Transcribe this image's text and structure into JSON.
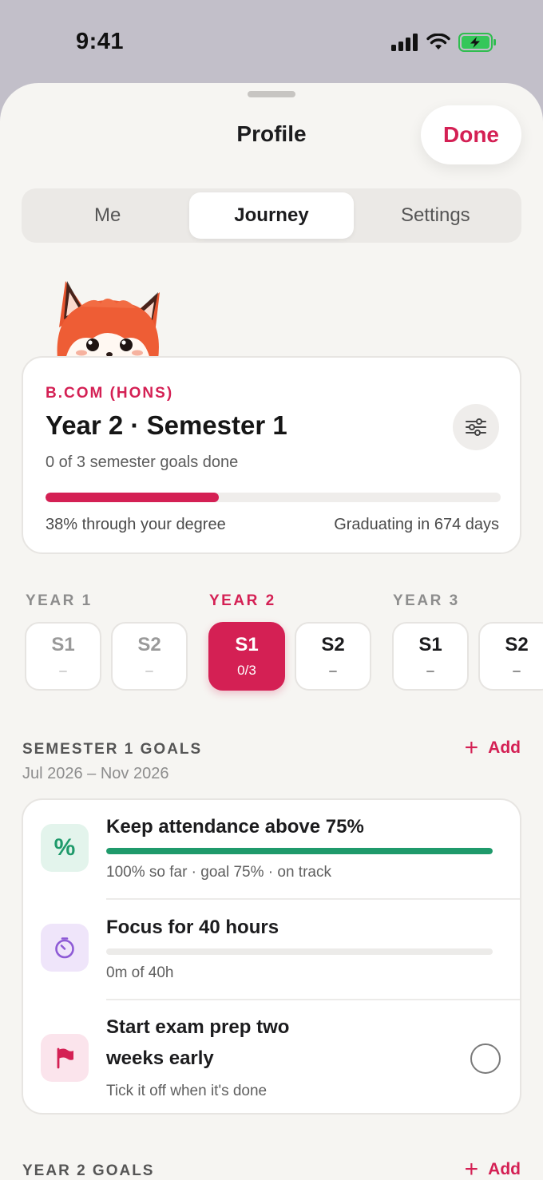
{
  "status_bar": {
    "time": "9:41"
  },
  "sheet": {
    "title": "Profile",
    "done_label": "Done"
  },
  "tabs": [
    {
      "label": "Me",
      "active": false
    },
    {
      "label": "Journey",
      "active": true
    },
    {
      "label": "Settings",
      "active": false
    }
  ],
  "degree": {
    "program": "B.COM (HONS)",
    "heading": "Year 2 · Semester 1",
    "goals_summary": "0 of 3 semester goals done",
    "progress_fraction": 0.38,
    "progress_text": "38% through your degree",
    "graduation_text": "Graduating in 674 days"
  },
  "timeline": {
    "years": [
      {
        "label": "YEAR 1",
        "current": false
      },
      {
        "label": "YEAR 2",
        "current": true
      },
      {
        "label": "YEAR 3",
        "current": false
      }
    ],
    "semesters": [
      {
        "name": "S1",
        "count": "–",
        "state": "past"
      },
      {
        "name": "S2",
        "count": "–",
        "state": "past"
      },
      {
        "name": "S1",
        "count": "0/3",
        "state": "current"
      },
      {
        "name": "S2",
        "count": "–",
        "state": "future"
      },
      {
        "name": "S1",
        "count": "–",
        "state": "future"
      },
      {
        "name": "S2",
        "count": "–",
        "state": "future"
      }
    ]
  },
  "semester_goals": {
    "title": "SEMESTER 1 GOALS",
    "dates": "Jul 2026 – Nov 2026",
    "add_label": "Add",
    "items": [
      {
        "icon": "percent-icon",
        "color": "#1f9a6b",
        "title": "Keep attendance above 75%",
        "progress_fraction": 1.0,
        "meta": "100% so far · goal 75% · on track"
      },
      {
        "icon": "timer-icon",
        "color": "#8e5bd6",
        "title": "Focus for 40 hours",
        "progress_fraction": 0.0,
        "meta": "0m of 40h"
      },
      {
        "icon": "flag-icon",
        "color": "#d42054",
        "title_line1": "Start exam prep two",
        "title_line2": "weeks early",
        "meta": "Tick it off when it's done",
        "done": false
      }
    ]
  },
  "year_goals": {
    "title": "YEAR 2 GOALS",
    "add_label": "Add"
  },
  "colors": {
    "accent": "#d42054",
    "success": "#1f9a6b",
    "background": "#f6f5f2"
  }
}
